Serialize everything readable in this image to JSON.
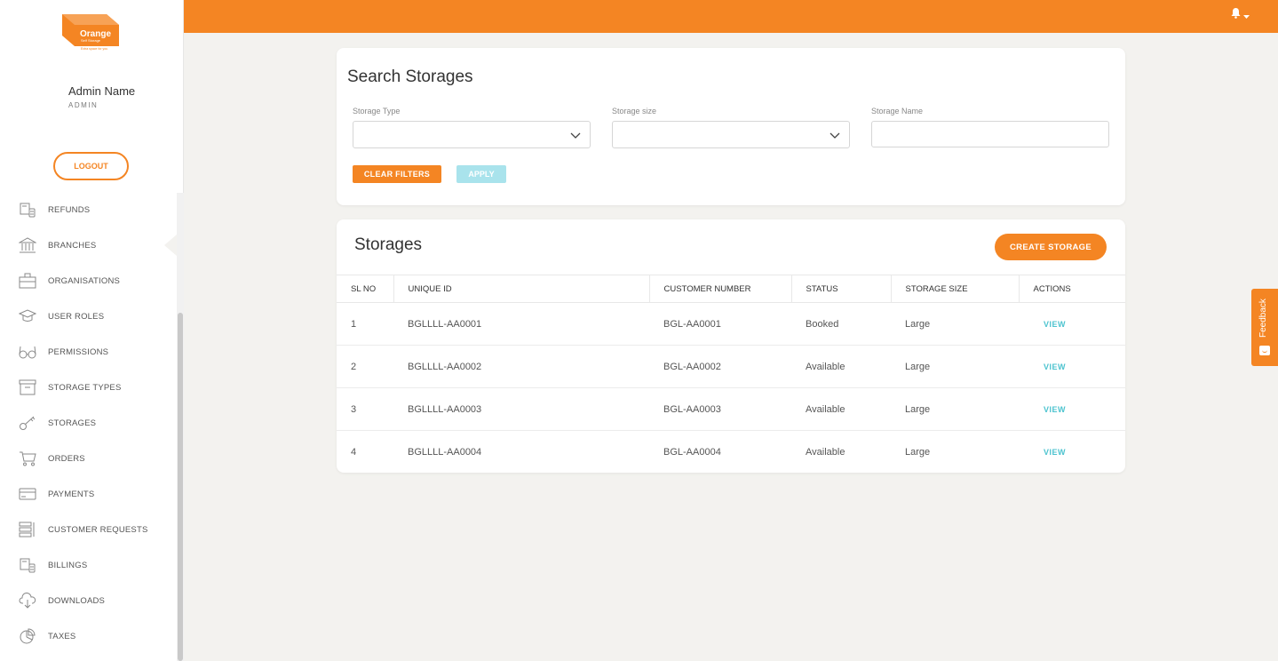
{
  "brand": {
    "accent": "#f48523",
    "link": "#4cc3cf",
    "logo_text": "Orange",
    "logo_sub": "Self Storage",
    "logo_tag": "Extra space for you"
  },
  "user": {
    "name": "Admin Name",
    "role": "ADMIN",
    "logout_label": "LOGOUT"
  },
  "nav": [
    {
      "label": "REFUNDS",
      "icon": "refunds-icon"
    },
    {
      "label": "BRANCHES",
      "icon": "bank-icon"
    },
    {
      "label": "ORGANISATIONS",
      "icon": "briefcase-icon"
    },
    {
      "label": "USER ROLES",
      "icon": "graduation-cap-icon"
    },
    {
      "label": "PERMISSIONS",
      "icon": "glasses-icon"
    },
    {
      "label": "STORAGE TYPES",
      "icon": "archive-box-icon"
    },
    {
      "label": "STORAGES",
      "icon": "key-icon"
    },
    {
      "label": "ORDERS",
      "icon": "cart-icon"
    },
    {
      "label": "PAYMENTS",
      "icon": "credit-card-icon"
    },
    {
      "label": "CUSTOMER REQUESTS",
      "icon": "list-icon"
    },
    {
      "label": "BILLINGS",
      "icon": "billing-icon"
    },
    {
      "label": "DOWNLOADS",
      "icon": "cloud-download-icon"
    },
    {
      "label": "TAXES",
      "icon": "pie-chart-icon"
    }
  ],
  "search": {
    "title": "Search Storages",
    "storage_type_label": "Storage Type",
    "storage_size_label": "Storage size",
    "storage_name_label": "Storage Name",
    "storage_type_value": "",
    "storage_size_value": "",
    "storage_name_value": "",
    "clear_label": "CLEAR FILTERS",
    "apply_label": "APPLY"
  },
  "storages": {
    "title": "Storages",
    "create_label": "CREATE STORAGE",
    "columns": [
      "SL NO",
      "UNIQUE ID",
      "CUSTOMER NUMBER",
      "STATUS",
      "STORAGE SIZE",
      "ACTIONS"
    ],
    "rows": [
      {
        "sl": "1",
        "unique_id": "BGLLLL-AA0001",
        "customer": "BGL-AA0001",
        "status": "Booked",
        "size": "Large",
        "action": "VIEW"
      },
      {
        "sl": "2",
        "unique_id": "BGLLLL-AA0002",
        "customer": "BGL-AA0002",
        "status": "Available",
        "size": "Large",
        "action": "VIEW"
      },
      {
        "sl": "3",
        "unique_id": "BGLLLL-AA0003",
        "customer": "BGL-AA0003",
        "status": "Available",
        "size": "Large",
        "action": "VIEW"
      },
      {
        "sl": "4",
        "unique_id": "BGLLLL-AA0004",
        "customer": "BGL-AA0004",
        "status": "Available",
        "size": "Large",
        "action": "VIEW"
      }
    ]
  },
  "feedback": {
    "label": "Feedback"
  }
}
